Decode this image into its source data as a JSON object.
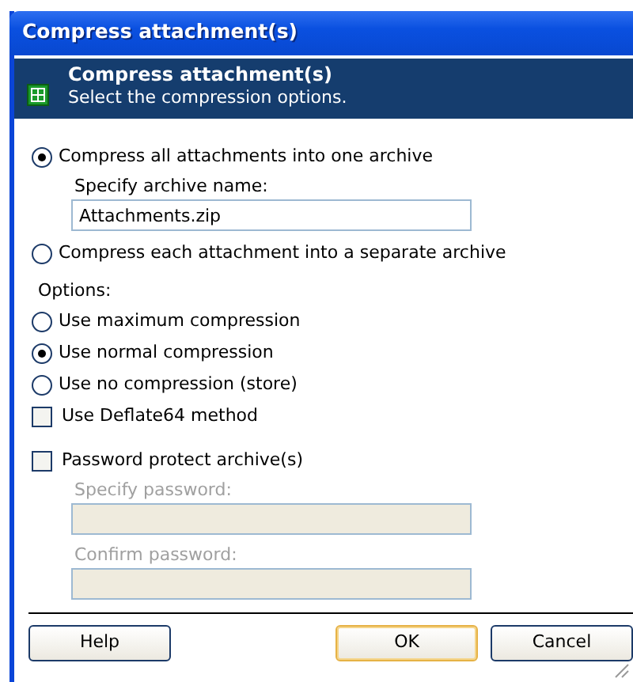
{
  "window": {
    "title": "Compress attachment(s)"
  },
  "header": {
    "title": "Compress attachment(s)",
    "subtitle": "Select the compression options."
  },
  "items": [
    {
      "kind": "radio",
      "label": "Compress all attachments into one archive",
      "selected": true
    },
    {
      "kind": "field",
      "label": "Specify archive name:",
      "value": "Attachments.zip",
      "disabled": false
    },
    {
      "kind": "radio",
      "label": "Compress each attachment into a separate archive",
      "selected": false
    },
    {
      "kind": "heading",
      "label": "Options:"
    },
    {
      "kind": "radio",
      "label": "Use maximum compression",
      "selected": false
    },
    {
      "kind": "radio",
      "label": "Use normal compression",
      "selected": true
    },
    {
      "kind": "radio",
      "label": "Use no compression (store)",
      "selected": false
    },
    {
      "kind": "checkbox",
      "label": "Use Deflate64 method",
      "checked": false
    },
    {
      "kind": "checkbox",
      "label": "Password protect archive(s)",
      "checked": false
    },
    {
      "kind": "field",
      "label": "Specify password:",
      "value": "",
      "disabled": true
    },
    {
      "kind": "field",
      "label": "Confirm password:",
      "value": "",
      "disabled": true
    }
  ],
  "buttons": [
    {
      "label": "Help",
      "default": false
    },
    {
      "label": "OK",
      "default": true
    },
    {
      "label": "Cancel",
      "default": false
    }
  ]
}
